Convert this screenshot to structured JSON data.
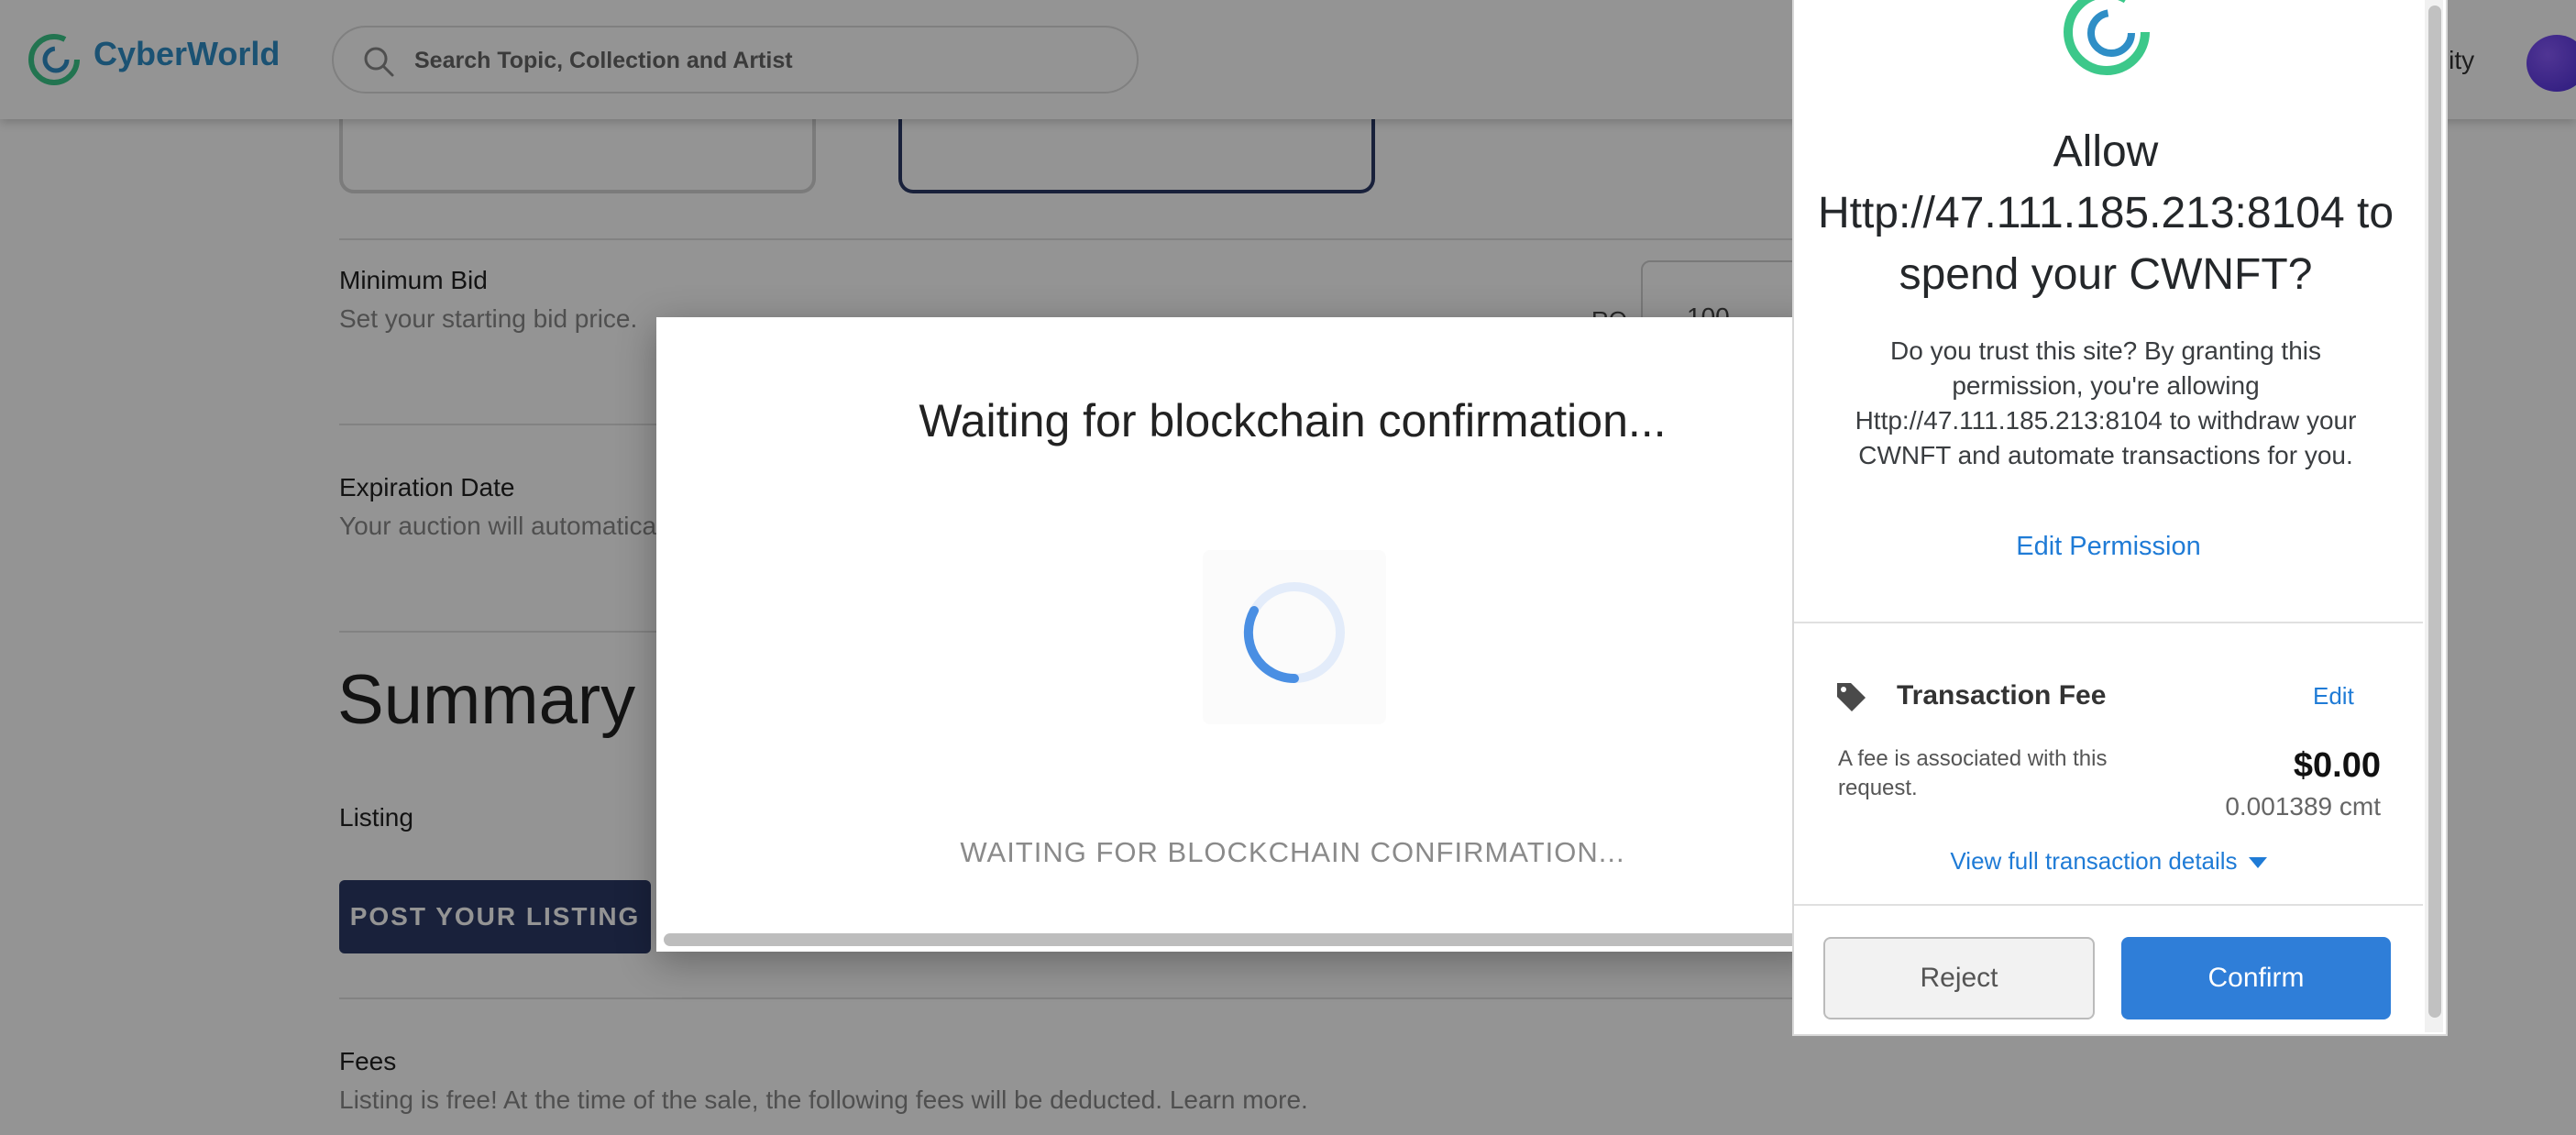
{
  "header": {
    "brand": "CyberWorld",
    "search_placeholder": "Search Topic, Collection and Artist",
    "community_fragment": "unity"
  },
  "form": {
    "min_bid_label": "Minimum Bid",
    "min_bid_sub": "Set your starting bid price.",
    "currency_fragment": "RO",
    "bid_value_fragment": "100",
    "expiration_label": "Expiration Date",
    "expiration_sub": "Your auction will automatica",
    "summary_heading": "Summary",
    "listing_label": "Listing",
    "post_button": "POST YOUR LISTING",
    "fees_label": "Fees",
    "fees_sub": "Listing is free! At the time of the sale, the following fees will be deducted. Learn more."
  },
  "modal": {
    "title": "Waiting for blockchain confirmation...",
    "status": "WAITING FOR BLOCKCHAIN CONFIRMATION..."
  },
  "wallet": {
    "title": "Allow Http://47.111.185.213:8104 to spend your CWNFT?",
    "description": "Do you trust this site? By granting this permission, you're allowing Http://47.111.185.213:8104 to withdraw your CWNFT and automate transactions for you.",
    "edit_permission": "Edit Permission",
    "fee_title": "Transaction Fee",
    "fee_edit": "Edit",
    "fee_description": "A fee is associated with this request.",
    "fee_usd": "$0.00",
    "fee_native": "0.001389 cmt",
    "view_details": "View full transaction details",
    "reject": "Reject",
    "confirm": "Confirm"
  },
  "colors": {
    "primary_navy": "#2b3a67",
    "link_blue": "#1f7bd6",
    "confirm_blue": "#2f7ed8",
    "logo_green": "#3cc88a"
  },
  "icons": [
    "cyberworld-logo-icon",
    "search-icon",
    "avatar",
    "spinner-icon",
    "tag-icon",
    "chevron-down-icon"
  ]
}
